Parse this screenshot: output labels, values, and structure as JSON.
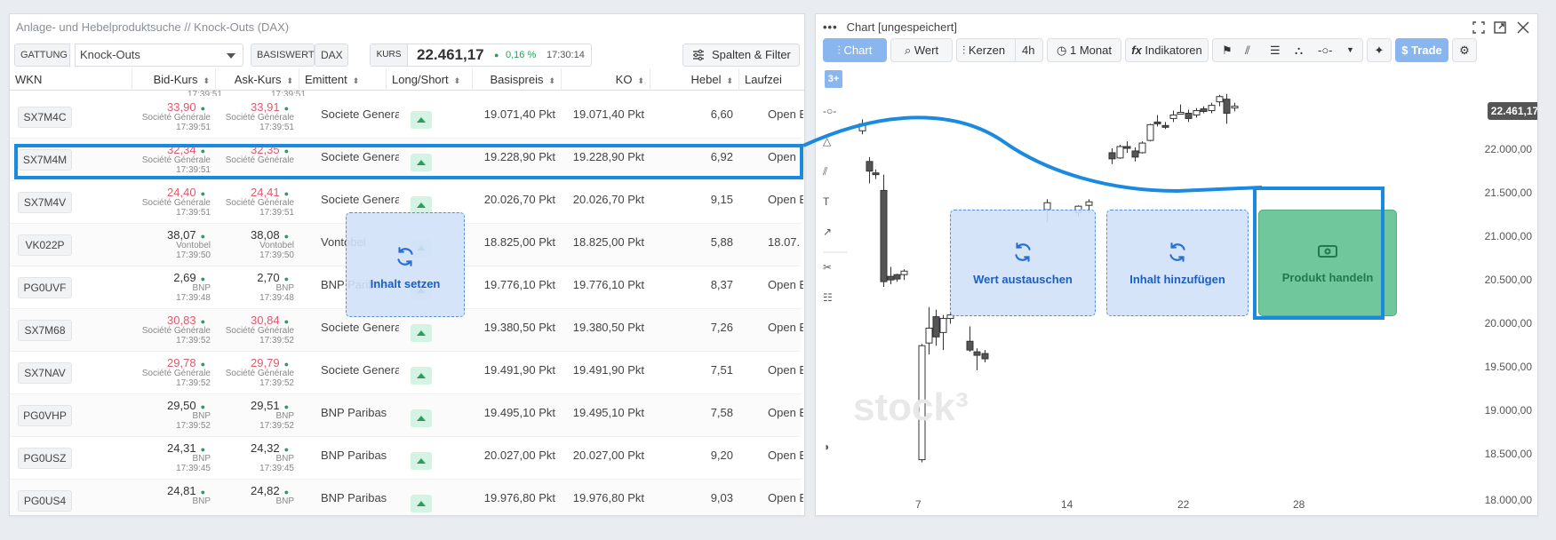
{
  "left_panel": {
    "title": "Anlage- und Hebelproduktsuche // Knock-Outs (DAX)",
    "filters": {
      "gattung_label": "GATTUNG",
      "gattung_value": "Knock-Outs",
      "basiswert_label": "BASISWERT",
      "basiswert_value": "DAX",
      "kurs_label": "KURS",
      "kurs_value": "22.461,17",
      "kurs_change": "0,16 %",
      "kurs_time": "17:30:14",
      "spalten_button": "Spalten & Filter"
    },
    "columns": [
      "WKN",
      "Bid-Kurs",
      "Ask-Kurs",
      "Emittent",
      "Long/Short",
      "Basispreis",
      "KO",
      "Hebel",
      "Laufzei"
    ],
    "partial_time": "17:39:51",
    "rows": [
      {
        "wkn": "SX7M4C",
        "bid": "33,90",
        "bid_red": true,
        "bid_src": "Société Générale",
        "bid_time": "17:39:51",
        "ask": "33,91",
        "ask_src": "Société Générale",
        "ask_time": "17:39:51",
        "emittent": "Societe Generale",
        "basis": "19.071,40 Pkt",
        "ko": "19.071,40 Pkt",
        "hebel": "6,60",
        "laufzeit": "Open End"
      },
      {
        "wkn": "SX7M4M",
        "bid": "32,34",
        "bid_red": true,
        "bid_src": "Société Générale",
        "bid_time": "17:39:51",
        "ask": "32,35",
        "ask_src": "Société Générale",
        "ask_time": "",
        "emittent": "Societe Generale",
        "basis": "19.228,90 Pkt",
        "ko": "19.228,90 Pkt",
        "hebel": "6,92",
        "laufzeit": "Open End"
      },
      {
        "wkn": "SX7M4V",
        "bid": "24,40",
        "bid_red": true,
        "bid_src": "Société Générale",
        "bid_time": "17:39:51",
        "ask": "24,41",
        "ask_src": "Société Générale",
        "ask_time": "17:39:51",
        "emittent": "Societe Generale",
        "basis": "20.026,70 Pkt",
        "ko": "20.026,70 Pkt",
        "hebel": "9,15",
        "laufzeit": "Open End"
      },
      {
        "wkn": "VK022P",
        "bid": "38,07",
        "bid_red": false,
        "bid_src": "Vontobel",
        "bid_time": "17:39:50",
        "ask": "38,08",
        "ask_src": "Vontobel",
        "ask_time": "17:39:50",
        "emittent": "Vontobel",
        "basis": "18.825,00 Pkt",
        "ko": "18.825,00 Pkt",
        "hebel": "5,88",
        "laufzeit": "18.07."
      },
      {
        "wkn": "PG0UVF",
        "bid": "2,69",
        "bid_red": false,
        "bid_src": "BNP",
        "bid_time": "17:39:48",
        "ask": "2,70",
        "ask_src": "BNP",
        "ask_time": "17:39:48",
        "emittent": "BNP Paribas",
        "basis": "19.776,10 Pkt",
        "ko": "19.776,10 Pkt",
        "hebel": "8,37",
        "laufzeit": "Open End"
      },
      {
        "wkn": "SX7M68",
        "bid": "30,83",
        "bid_red": true,
        "bid_src": "Société Générale",
        "bid_time": "17:39:52",
        "ask": "30,84",
        "ask_src": "Société Générale",
        "ask_time": "17:39:52",
        "emittent": "Societe Generale",
        "basis": "19.380,50 Pkt",
        "ko": "19.380,50 Pkt",
        "hebel": "7,26",
        "laufzeit": "Open End"
      },
      {
        "wkn": "SX7NAV",
        "bid": "29,78",
        "bid_red": true,
        "bid_src": "Société Générale",
        "bid_time": "17:39:52",
        "ask": "29,79",
        "ask_src": "Société Générale",
        "ask_time": "17:39:52",
        "emittent": "Societe Generale",
        "basis": "19.491,90 Pkt",
        "ko": "19.491,90 Pkt",
        "hebel": "7,51",
        "laufzeit": "Open End"
      },
      {
        "wkn": "PG0VHP",
        "bid": "29,50",
        "bid_red": false,
        "bid_src": "BNP",
        "bid_time": "17:39:52",
        "ask": "29,51",
        "ask_src": "BNP",
        "ask_time": "17:39:52",
        "emittent": "BNP Paribas",
        "basis": "19.495,10 Pkt",
        "ko": "19.495,10 Pkt",
        "hebel": "7,58",
        "laufzeit": "Open End"
      },
      {
        "wkn": "PG0USZ",
        "bid": "24,31",
        "bid_red": false,
        "bid_src": "BNP",
        "bid_time": "17:39:45",
        "ask": "24,32",
        "ask_src": "BNP",
        "ask_time": "17:39:45",
        "emittent": "BNP Paribas",
        "basis": "20.027,00 Pkt",
        "ko": "20.027,00 Pkt",
        "hebel": "9,20",
        "laufzeit": "Open End"
      },
      {
        "wkn": "PG0US4",
        "bid": "24,81",
        "bid_red": false,
        "bid_src": "BNP",
        "bid_time": "",
        "ask": "24,82",
        "ask_src": "BNP",
        "ask_time": "",
        "emittent": "BNP Paribas",
        "basis": "19.976,80 Pkt",
        "ko": "19.976,80 Pkt",
        "hebel": "9,03",
        "laufzeit": "Open End"
      }
    ],
    "drop_set": "Inhalt setzen"
  },
  "right_panel": {
    "title": "Chart [ungespeichert]",
    "toolbar": {
      "chart": "Chart",
      "wert": "Wert",
      "kerzen": "Kerzen",
      "interval": "4h",
      "range": "1 Monat",
      "indikatoren": "Indikatoren",
      "trade": "Trade"
    },
    "drop_replace": "Wert austauschen",
    "drop_add": "Inhalt hinzufügen",
    "drop_trade": "Produkt handeln",
    "watermark": "stock³",
    "current_value": "22.461,17",
    "badge": "3+",
    "colors": {
      "accent": "#1a8ae0",
      "positive": "#2a9d5c",
      "negative": "#e05a6c",
      "trade_green": "#5ac48e"
    }
  },
  "chart_data": {
    "type": "candlestick",
    "title": "",
    "y_ticks": [
      "22.000,00",
      "21.500,00",
      "21.000,00",
      "20.500,00",
      "20.000,00",
      "19.500,00",
      "19.000,00",
      "18.500,00",
      "18.000,00"
    ],
    "x_ticks": [
      "7",
      "14",
      "22",
      "28"
    ],
    "last_value": "22.461,17"
  }
}
